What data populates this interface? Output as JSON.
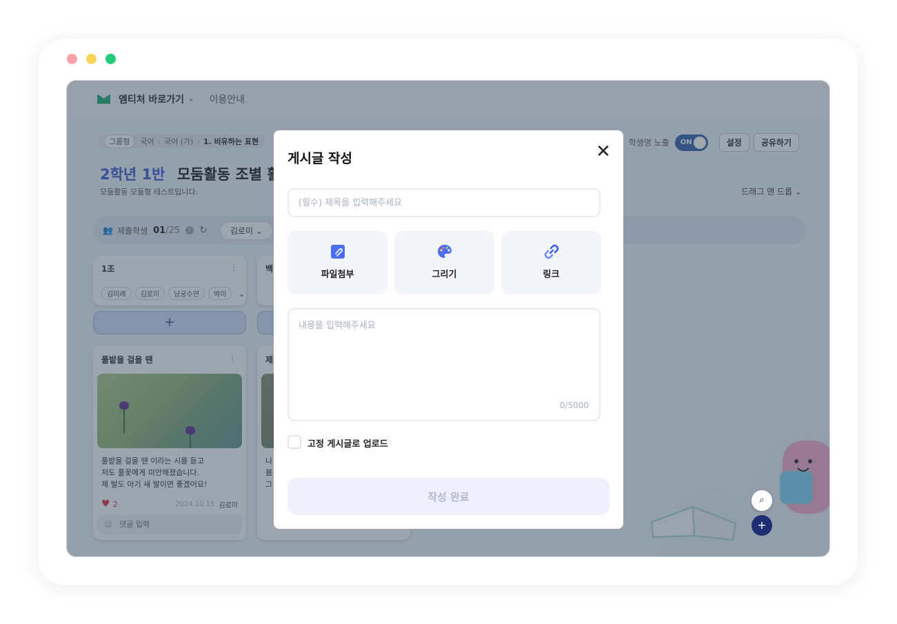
{
  "app": {
    "brand": "엠티처 바로가기",
    "guide": "이용안내"
  },
  "breadcrumb": {
    "tag": "그룹형",
    "items": [
      "국어",
      "국어 (가)",
      "1. 비유하는 표현"
    ]
  },
  "page": {
    "class_name": "2학년 1반",
    "activity": "모둠활동 조별 활동",
    "subtitle": "모둠활동 모둠형 테스트입니다."
  },
  "header_controls": {
    "student_name_label": "학생명 노출",
    "toggle_state": "ON",
    "settings": "설정",
    "share": "공유하기",
    "sort": "드래그 앤 드롭"
  },
  "toolbar": {
    "submitted_label": "제출학생",
    "submitted_count": "01",
    "total_count": "/25",
    "filter_student": "김로미"
  },
  "groups": [
    {
      "name": "1조",
      "members": [
        "김미래",
        "김로미",
        "남궁수연",
        "박미"
      ],
      "post": {
        "title": "풀밭을 걸을 땐",
        "body_lines": [
          "풀밭을 걸을 땐 이라는 시를 듣고",
          "저도 풀꽃에게 미안해졌습니다.",
          "제 발도 아기 새 발이면 좋겠어요!"
        ],
        "likes": "2",
        "date": "2024.10.15",
        "author": "김로미",
        "comment_placeholder": "댓글 입력"
      }
    },
    {
      "name": "백",
      "post": {
        "title": "제",
        "body_lines": [
          "나",
          "봄",
          "그"
        ]
      }
    }
  ],
  "modal": {
    "title": "게시글 작성",
    "title_placeholder": "(필수) 제목을 입력해주세요",
    "tiles": [
      {
        "label": "파일첨부",
        "icon": "paperclip-icon"
      },
      {
        "label": "그리기",
        "icon": "palette-icon"
      },
      {
        "label": "링크",
        "icon": "link-icon"
      }
    ],
    "content_placeholder": "내용을 입력해주세요",
    "counter": "0/5000",
    "pin_label": "고정 게시글로 업로드",
    "submit": "작성 완료"
  },
  "colors": {
    "accent": "#2e55c9",
    "brand_green": "#12a86b",
    "fab": "#1e2e73"
  }
}
